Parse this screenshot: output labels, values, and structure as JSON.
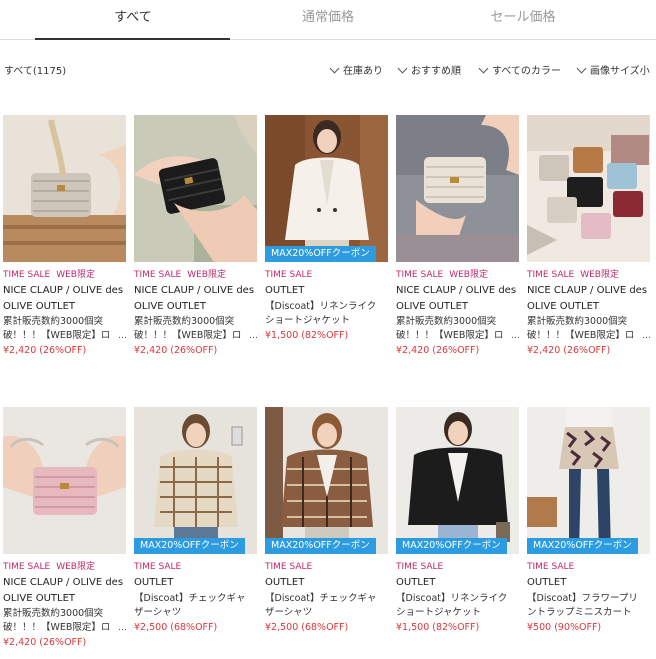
{
  "tabs": [
    {
      "label": "すべて"
    },
    {
      "label": "通常価格"
    },
    {
      "label": "セール価格"
    }
  ],
  "count_label": "すべて(1175)",
  "filters": [
    {
      "label": "在庫あり"
    },
    {
      "label": "おすすめ順"
    },
    {
      "label": "すべてのカラー"
    },
    {
      "label": "画像サイズ小"
    }
  ],
  "colors": {
    "sale": "#c1296b",
    "price": "#d9383a",
    "coupon": "#2d9be0"
  },
  "products": [
    {
      "tags": [
        "TIME SALE",
        "WEB限定"
      ],
      "brand": "NICE CLAUP / OLIVE des OLIVE OUTLET",
      "title": "累計販売数約3000個突破！！！【WEB限定】ロ",
      "price": "¥2,420 (26%OFF)",
      "coupon": ""
    },
    {
      "tags": [
        "TIME SALE",
        "WEB限定"
      ],
      "brand": "NICE CLAUP / OLIVE des OLIVE OUTLET",
      "title": "累計販売数約3000個突破！！！【WEB限定】ロ",
      "price": "¥2,420 (26%OFF)",
      "coupon": ""
    },
    {
      "tags": [
        "TIME SALE"
      ],
      "brand": "OUTLET",
      "title": "【Discoat】リネンライクショートジャケット",
      "price": "¥1,500 (82%OFF)",
      "coupon": "MAX20%OFFクーポン"
    },
    {
      "tags": [
        "TIME SALE",
        "WEB限定"
      ],
      "brand": "NICE CLAUP / OLIVE des OLIVE OUTLET",
      "title": "累計販売数約3000個突破！！！【WEB限定】ロ",
      "price": "¥2,420 (26%OFF)",
      "coupon": ""
    },
    {
      "tags": [
        "TIME SALE",
        "WEB限定"
      ],
      "brand": "NICE CLAUP / OLIVE des OLIVE OUTLET",
      "title": "累計販売数約3000個突破！！！【WEB限定】ロ",
      "price": "¥2,420 (26%OFF)",
      "coupon": ""
    },
    {
      "tags": [
        "TIME SALE",
        "WEB限定"
      ],
      "brand": "NICE CLAUP / OLIVE des OLIVE OUTLET",
      "title": "累計販売数約3000個突破！！！【WEB限定】ロ",
      "price": "¥2,420 (26%OFF)",
      "coupon": ""
    },
    {
      "tags": [
        "TIME SALE"
      ],
      "brand": "OUTLET",
      "title": "【Discoat】チェックギャザーシャツ",
      "price": "¥2,500 (68%OFF)",
      "coupon": "MAX20%OFFクーポン"
    },
    {
      "tags": [
        "TIME SALE"
      ],
      "brand": "OUTLET",
      "title": "【Discoat】チェックギャザーシャツ",
      "price": "¥2,500 (68%OFF)",
      "coupon": "MAX20%OFFクーポン"
    },
    {
      "tags": [
        "TIME SALE"
      ],
      "brand": "OUTLET",
      "title": "【Discoat】リネンライクショートジャケット",
      "price": "¥1,500 (82%OFF)",
      "coupon": "MAX20%OFFクーポン"
    },
    {
      "tags": [
        "TIME SALE"
      ],
      "brand": "OUTLET",
      "title": "【Discoat】フラワープリントラップミニスカート",
      "price": "¥500 (90%OFF)",
      "coupon": "MAX20%OFFクーポン"
    }
  ]
}
